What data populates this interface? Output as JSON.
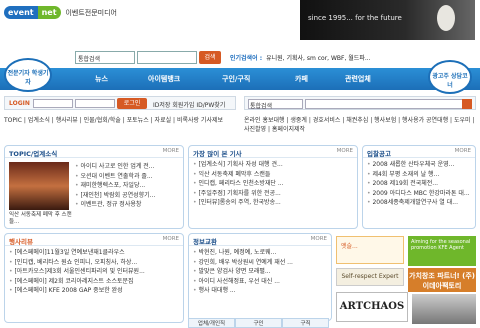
{
  "header": {
    "logo_part1": "event",
    "logo_part2": "net",
    "logo_tagline": "이벤트전문미디어",
    "top_ad_text": "since 1995... for the future"
  },
  "search": {
    "select_value": "통합검색",
    "button_label": "검색",
    "popular_label": "인기검색어 :",
    "popular_terms": "유니원, 기획사, sm cor, WBF, 월드파..."
  },
  "nav": {
    "left_badge": "전문기자 학생기자",
    "items": [
      "뉴스",
      "아이템뱅크",
      "구인/구직",
      "카페",
      "관련업체"
    ],
    "right_badge": "광고주 상담코너"
  },
  "login": {
    "label": "LOGIN",
    "button": "로그인",
    "links": "ID저장  회원가입  ID/PW찾기"
  },
  "search2": {
    "select_value": "통합검색"
  },
  "topic_links": "TOPIC | 업계소식 | 행사리뷰 | 인물/협회/학술 | 포토뉴스 | 자료실 | 비록사랑 기사제보",
  "topic_links2": "온라인 홍보대행 | 생중계 | 경호서비스 | 채권추심 | 행사보험 | 행사용가 공연대행 | 도우미 | 사진촬영 | 홈페이지제작",
  "panels": {
    "topic": {
      "title": "TOPIC/업계소식",
      "more": "MORE",
      "caption": "익산 서동축제 폐막 후 스캔들...",
      "items": [
        "아이디 사고로 인한 업계 전...",
        "오션대 이벤트 연출학과 졸...",
        "재미한행렉스포, 자일당...",
        "[재인천] 박람회 공연성향기...",
        "이벤트관, 정규 정사용창"
      ]
    },
    "hot": {
      "title": "가장 많이 본 기사",
      "more": "MORE",
      "items": [
        "[업계소식] 기획사 자성 대행 견...",
        "익산 서동축제 폐막후 스캔들",
        "인디캡, 페리타스 인천소방재단 ...",
        "[주일주점] 기획자를 위한 전공...",
        "[인터뷰]롬송의 주역, 한국방송..."
      ]
    },
    "notice": {
      "title": "입찰공고",
      "more": "MORE",
      "items": [
        "2008 새롭한 산타우체국 운영...",
        "제4회 부평 소재의 날 행...",
        "2008 제19회 전국체전...",
        "2009 아디다스 MBC 한강마라톤 대...",
        "2008세종축제개발연구사 열 대..."
      ]
    },
    "news": {
      "title": "행사리뷰",
      "more": "MORE",
      "items": [
        "[에스페메이]11월3일 연예보낸재1클라우스",
        "[인디캡, 베리타스 원쇼 인피니, 오피칭사, 하상...",
        "[아트카오스]제3회 서울인센티파리의 및 인터뷰원...",
        "[에스페메이] 제2회 코리아레지스트 소스토문집",
        "[에스페메이] KFE 2008 GAP 중보한 완성"
      ]
    },
    "info": {
      "title": "정보교환",
      "more": "MORE",
      "items": [
        "박현진, 나원, 예정예, 노로웨...",
        "강민희, 배우 박상원씨 연예계 재선 ...",
        "발맞은 양검사 양면 모래펼...",
        "아이디 사선해정표, 우선 대신 ...",
        "행사 대대행 ..."
      ],
      "tabs": [
        "업체/개인직",
        "구인",
        "구직"
      ]
    }
  },
  "ads": {
    "orange_1": "엣슬...",
    "green": "Aiming for the seasonal promotion KFE Agent",
    "self_respect": "Self-respect Expert",
    "partner": "가치창조 파트너! (주)이데아팩토리",
    "artchaos": "ARTCHAOS"
  },
  "colors": {
    "nav_blue": "#1c6fb8",
    "accent_orange": "#d65a24",
    "brand_green": "#6fb72b"
  }
}
